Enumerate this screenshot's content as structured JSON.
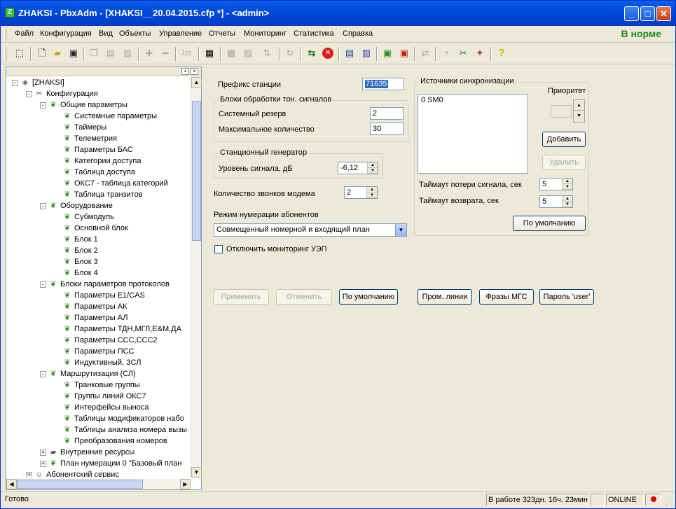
{
  "window": {
    "title": "ZHAKSI - PbxAdm - [XHAKSI__20.04.2015.cfp *]  - <admin>",
    "app_icon_letter": "Z"
  },
  "menu": {
    "items": [
      "Файл",
      "Конфигурация",
      "Вид",
      "Объекты",
      "Управление",
      "Отчеты",
      "Мониторинг",
      "Статистика",
      "Справка"
    ],
    "status": "В норме"
  },
  "toolbar": {
    "icons": [
      "cursor-icon",
      "new-doc-icon",
      "open-folder-icon",
      "save-icon",
      "copy-icon",
      "paste-icon",
      "paste-special-icon",
      "add-icon",
      "remove-icon",
      "numbering-icon",
      "properties-icon",
      "grid-icon",
      "grid2-icon",
      "sort-icon",
      "refresh-icon",
      "connect-icon",
      "cancel-icon",
      "export-icon",
      "import-icon",
      "upload-icon",
      "download-icon",
      "sync-icon",
      "monitor-icon",
      "tools-icon",
      "wand-icon",
      "help-icon"
    ],
    "sub_label": "1",
    "sub_label2": "23"
  },
  "tree": {
    "items": [
      {
        "label": "[ZHAKSI]",
        "level": 0,
        "exp": "-",
        "icon": "station-icon"
      },
      {
        "label": "Конфигурация",
        "level": 1,
        "exp": "-",
        "icon": "tools-icon"
      },
      {
        "label": "Общие параметры",
        "level": 2,
        "exp": "-",
        "icon": "leaf-icon"
      },
      {
        "label": "Системные параметры",
        "level": 3,
        "exp": "",
        "icon": "leaf-icon"
      },
      {
        "label": "Таймеры",
        "level": 3,
        "exp": "",
        "icon": "leaf-icon"
      },
      {
        "label": "Телеметрия",
        "level": 3,
        "exp": "",
        "icon": "leaf-icon"
      },
      {
        "label": "Параметры БАС",
        "level": 3,
        "exp": "",
        "icon": "leaf-icon"
      },
      {
        "label": "Категории доступа",
        "level": 3,
        "exp": "",
        "icon": "leaf-icon"
      },
      {
        "label": "Таблица доступа",
        "level": 3,
        "exp": "",
        "icon": "leaf-icon"
      },
      {
        "label": "ОКС7 - таблица категорий",
        "level": 3,
        "exp": "",
        "icon": "leaf-icon"
      },
      {
        "label": "Таблица транзитов",
        "level": 3,
        "exp": "",
        "icon": "leaf-icon"
      },
      {
        "label": "Оборудование",
        "level": 2,
        "exp": "-",
        "icon": "leaf-icon"
      },
      {
        "label": "Субмодуль",
        "level": 3,
        "exp": "",
        "icon": "leaf-icon"
      },
      {
        "label": "Основной блок",
        "level": 3,
        "exp": "",
        "icon": "leaf-icon"
      },
      {
        "label": "Блок 1",
        "level": 3,
        "exp": "",
        "icon": "leaf-icon"
      },
      {
        "label": "Блок 2",
        "level": 3,
        "exp": "",
        "icon": "leaf-icon"
      },
      {
        "label": "Блок 3",
        "level": 3,
        "exp": "",
        "icon": "leaf-icon"
      },
      {
        "label": "Блок 4",
        "level": 3,
        "exp": "",
        "icon": "leaf-icon"
      },
      {
        "label": "Блоки параметров протоколов",
        "level": 2,
        "exp": "-",
        "icon": "leaf-icon"
      },
      {
        "label": "Параметры E1/CAS",
        "level": 3,
        "exp": "",
        "icon": "leaf-icon"
      },
      {
        "label": "Параметры АК",
        "level": 3,
        "exp": "",
        "icon": "leaf-icon"
      },
      {
        "label": "Параметры АЛ",
        "level": 3,
        "exp": "",
        "icon": "leaf-icon"
      },
      {
        "label": "Параметры ТДН,МГЛ,Е&М,ДА",
        "level": 3,
        "exp": "",
        "icon": "leaf-icon"
      },
      {
        "label": "Параметры ССС,ССС2",
        "level": 3,
        "exp": "",
        "icon": "leaf-icon"
      },
      {
        "label": "Параметры ПСС",
        "level": 3,
        "exp": "",
        "icon": "leaf-icon"
      },
      {
        "label": "Индуктивный, ЗСЛ",
        "level": 3,
        "exp": "",
        "icon": "leaf-icon"
      },
      {
        "label": "Маршрутизация (СЛ)",
        "level": 2,
        "exp": "-",
        "icon": "leaf-icon"
      },
      {
        "label": "Транковые группы",
        "level": 3,
        "exp": "",
        "icon": "leaf-icon"
      },
      {
        "label": "Группы линий ОКС7",
        "level": 3,
        "exp": "",
        "icon": "leaf-icon"
      },
      {
        "label": "Интерфейсы выноса",
        "level": 3,
        "exp": "",
        "icon": "leaf-icon"
      },
      {
        "label": "Таблицы модификаторов набо",
        "level": 3,
        "exp": "",
        "icon": "leaf-icon"
      },
      {
        "label": "Таблицы анализа номера вызы",
        "level": 3,
        "exp": "",
        "icon": "leaf-icon"
      },
      {
        "label": "Преобразования номеров",
        "level": 3,
        "exp": "",
        "icon": "leaf-icon"
      },
      {
        "label": "Внутренние ресурсы",
        "level": 2,
        "exp": "+",
        "icon": "book-icon"
      },
      {
        "label": "План нумерации 0 \"Базовый план",
        "level": 2,
        "exp": "+",
        "icon": "leaf-icon"
      },
      {
        "label": "Абонентский сервис",
        "level": 1,
        "exp": "+",
        "icon": "users-icon"
      }
    ]
  },
  "form": {
    "prefix_label": "Префикс станции",
    "prefix_value": "71635",
    "tone_group": "Блоки обработки тон. сигналов",
    "reserve_label": "Системный резерв",
    "reserve_value": "2",
    "max_label": "Максимальное количество",
    "max_value": "30",
    "gen_group": "Станционный генератор",
    "level_label": "Уровень сигнала, дБ",
    "level_value": "-6,12",
    "modem_label": "Количество звонков модема",
    "modem_value": "2",
    "mode_label": "Режим нумерации абонентов",
    "mode_value": "Совмещенный номерной и входящий план",
    "monitor_label": "Отключить мониторинг УЭП",
    "sync_group": "Источники синхронизации",
    "sync_items": [
      "0  SM0"
    ],
    "priority_label": "Приоритет",
    "add_btn": "Добавить",
    "del_btn": "Удалить",
    "loss_label": "Таймаут потери сигнала, сек",
    "loss_value": "5",
    "ret_label": "Таймаут возврата, сек",
    "ret_value": "5",
    "sync_default_btn": "По умолчанию",
    "apply_btn": "Применить",
    "cancel_btn": "Отменить",
    "default_btn": "По умолчанию",
    "lines_btn": "Пром. линии",
    "phrases_btn": "Фразы МГС",
    "password_btn": "Пароль 'user'"
  },
  "status": {
    "ready": "Готово",
    "uptime": "В работе 323дн. 16ч. 23мин.",
    "online": "ONLINE",
    "indicator_color": "#e00000"
  },
  "colors": {
    "title_blue": "#0a5ee8",
    "ok_green": "#1f8a1f",
    "selection": "#316ac5"
  }
}
